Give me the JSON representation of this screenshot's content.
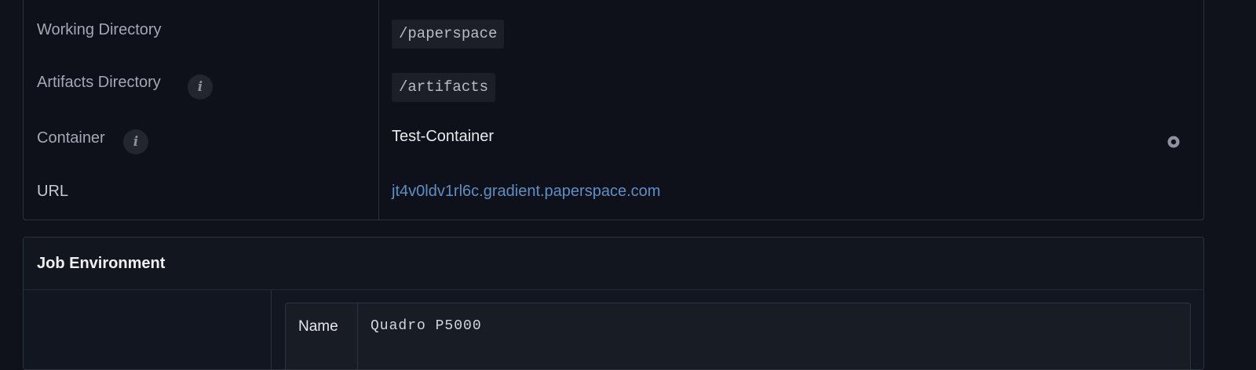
{
  "details": {
    "rows": [
      {
        "label": "Working Directory",
        "value": "/paperspace"
      },
      {
        "label": "Artifacts Directory",
        "value": "/artifacts"
      },
      {
        "label": "Container",
        "value": "Test-Container"
      },
      {
        "label": "URL",
        "value": "jt4v0ldv1rl6c.gradient.paperspace.com"
      }
    ],
    "info_glyph": "i"
  },
  "job_environment": {
    "title": "Job Environment",
    "rows": [
      {
        "key": "Name",
        "value": "Quadro P5000"
      }
    ]
  },
  "colors": {
    "background": "#0f121b",
    "border": "#2c313e",
    "link": "#5d8fc4"
  },
  "icons": [
    "info-icon",
    "gear-icon"
  ]
}
